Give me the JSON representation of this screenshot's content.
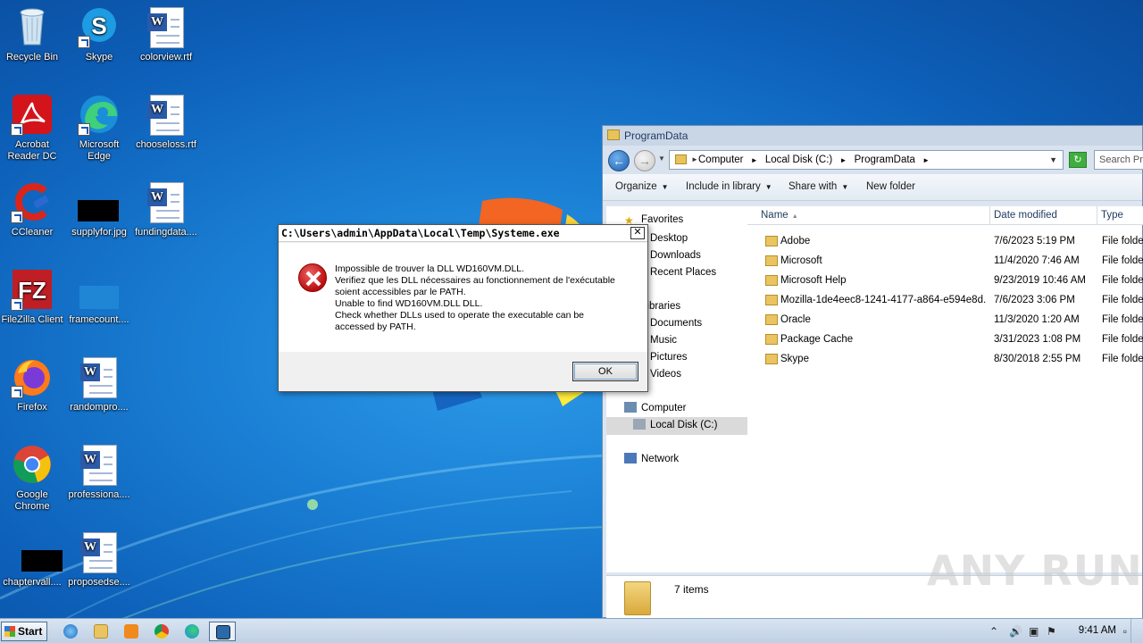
{
  "desktop": {
    "icons": [
      {
        "label": "Recycle Bin"
      },
      {
        "label": "Skype"
      },
      {
        "label": "colorview.rtf"
      },
      {
        "label": "Acrobat Reader DC"
      },
      {
        "label": "Microsoft Edge"
      },
      {
        "label": "chooseloss.rtf"
      },
      {
        "label": "CCleaner"
      },
      {
        "label": "supplyfor.jpg"
      },
      {
        "label": "fundingdata...."
      },
      {
        "label": "FileZilla Client"
      },
      {
        "label": "framecount...."
      },
      {
        "label": "Firefox"
      },
      {
        "label": "randompro...."
      },
      {
        "label": "Google Chrome"
      },
      {
        "label": "professiona...."
      },
      {
        "label": "chaptervall...."
      },
      {
        "label": "proposedse...."
      }
    ]
  },
  "dialog": {
    "title": "C:\\Users\\admin\\AppData\\Local\\Temp\\Systeme.exe",
    "close_glyph": "✕",
    "lines": [
      "Impossible de trouver la DLL WD160VM.DLL.",
      "Verifiez que les DLL nécessaires au fonctionnement de l'exécutable",
      "soient accessibles par le PATH.",
      "Unable to find WD160VM.DLL DLL.",
      "Check whether DLLs used to operate the executable can be",
      "accessed by PATH."
    ],
    "ok_label": "OK"
  },
  "explorer": {
    "title": "ProgramData",
    "address": [
      "Computer",
      "Local Disk (C:)",
      "ProgramData"
    ],
    "search_placeholder": "Search Pro",
    "toolbar": {
      "organize": "Organize",
      "include": "Include in library",
      "share": "Share with",
      "new_folder": "New folder"
    },
    "nav": {
      "favorites": "Favorites",
      "desktop": "Desktop",
      "downloads": "Downloads",
      "recent": "Recent Places",
      "libraries": "Libraries",
      "documents": "Documents",
      "music": "Music",
      "pictures": "Pictures",
      "videos": "Videos",
      "computer": "Computer",
      "local_disk": "Local Disk (C:)",
      "network": "Network"
    },
    "columns": {
      "name": "Name",
      "date": "Date modified",
      "type": "Type"
    },
    "files": [
      {
        "name": "Adobe",
        "date": "7/6/2023 5:19 PM",
        "type": "File folder"
      },
      {
        "name": "Microsoft",
        "date": "11/4/2020 7:46 AM",
        "type": "File folder"
      },
      {
        "name": "Microsoft Help",
        "date": "9/23/2019 10:46 AM",
        "type": "File folder"
      },
      {
        "name": "Mozilla-1de4eec8-1241-4177-a864-e594e8d...",
        "date": "7/6/2023 3:06 PM",
        "type": "File folder"
      },
      {
        "name": "Oracle",
        "date": "11/3/2020 1:20 AM",
        "type": "File folder"
      },
      {
        "name": "Package Cache",
        "date": "3/31/2023 1:08 PM",
        "type": "File folder"
      },
      {
        "name": "Skype",
        "date": "8/30/2018 2:55 PM",
        "type": "File folder"
      }
    ],
    "status": "7 items"
  },
  "watermark": "ANY RUN",
  "taskbar": {
    "start_label": "Start",
    "clock": "9:41 AM"
  },
  "colors": {
    "accent": "#1a7fd4",
    "dialog_title_bg": "#ffffff",
    "error_red": "#c41414"
  }
}
